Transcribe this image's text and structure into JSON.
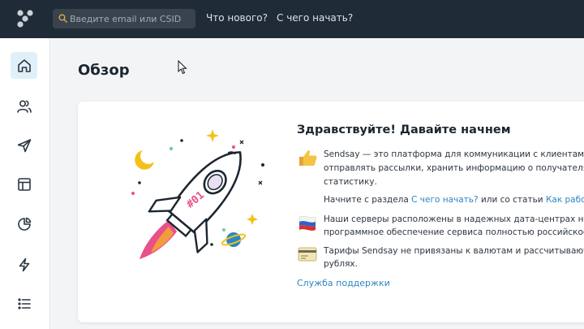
{
  "header": {
    "search_placeholder": "Введите email или CSID",
    "nav": [
      "Что нового?",
      "С чего начать?"
    ]
  },
  "sidebar": {
    "items": [
      {
        "icon": "home-icon",
        "active": true
      },
      {
        "icon": "users-icon"
      },
      {
        "icon": "send-icon"
      },
      {
        "icon": "layout-icon"
      },
      {
        "icon": "pie-chart-icon"
      },
      {
        "icon": "lightning-icon"
      },
      {
        "icon": "list-icon"
      }
    ]
  },
  "page": {
    "title": "Обзор"
  },
  "welcome": {
    "title": "Здравствуйте! Давайте начнем",
    "p1_lines": [
      "Sendsay — это платформа для коммуникации с клиентами: зд",
      "отправлять рассылки, хранить информацию о получателях и",
      "статистику."
    ],
    "p2_prefix": "Начните с раздела ",
    "p2_link1": "С чего начать?",
    "p2_mid": " или со статьи ",
    "p2_link2": "Как работает",
    "p3_lines": [
      "Наши серверы расположены в надежных дата-центрах на те",
      "программное обеспечение сервиса полностью российское."
    ],
    "p4_lines": [
      "Тарифы Sendsay не привязаны к валютам и рассчитываются",
      "рублях."
    ],
    "support_link": "Служба поддержки"
  },
  "colors": {
    "topbar": "#1f2c38",
    "accent": "#2b86c5",
    "active_bg": "#dff0f8",
    "rocket_pink": "#e8508b"
  }
}
